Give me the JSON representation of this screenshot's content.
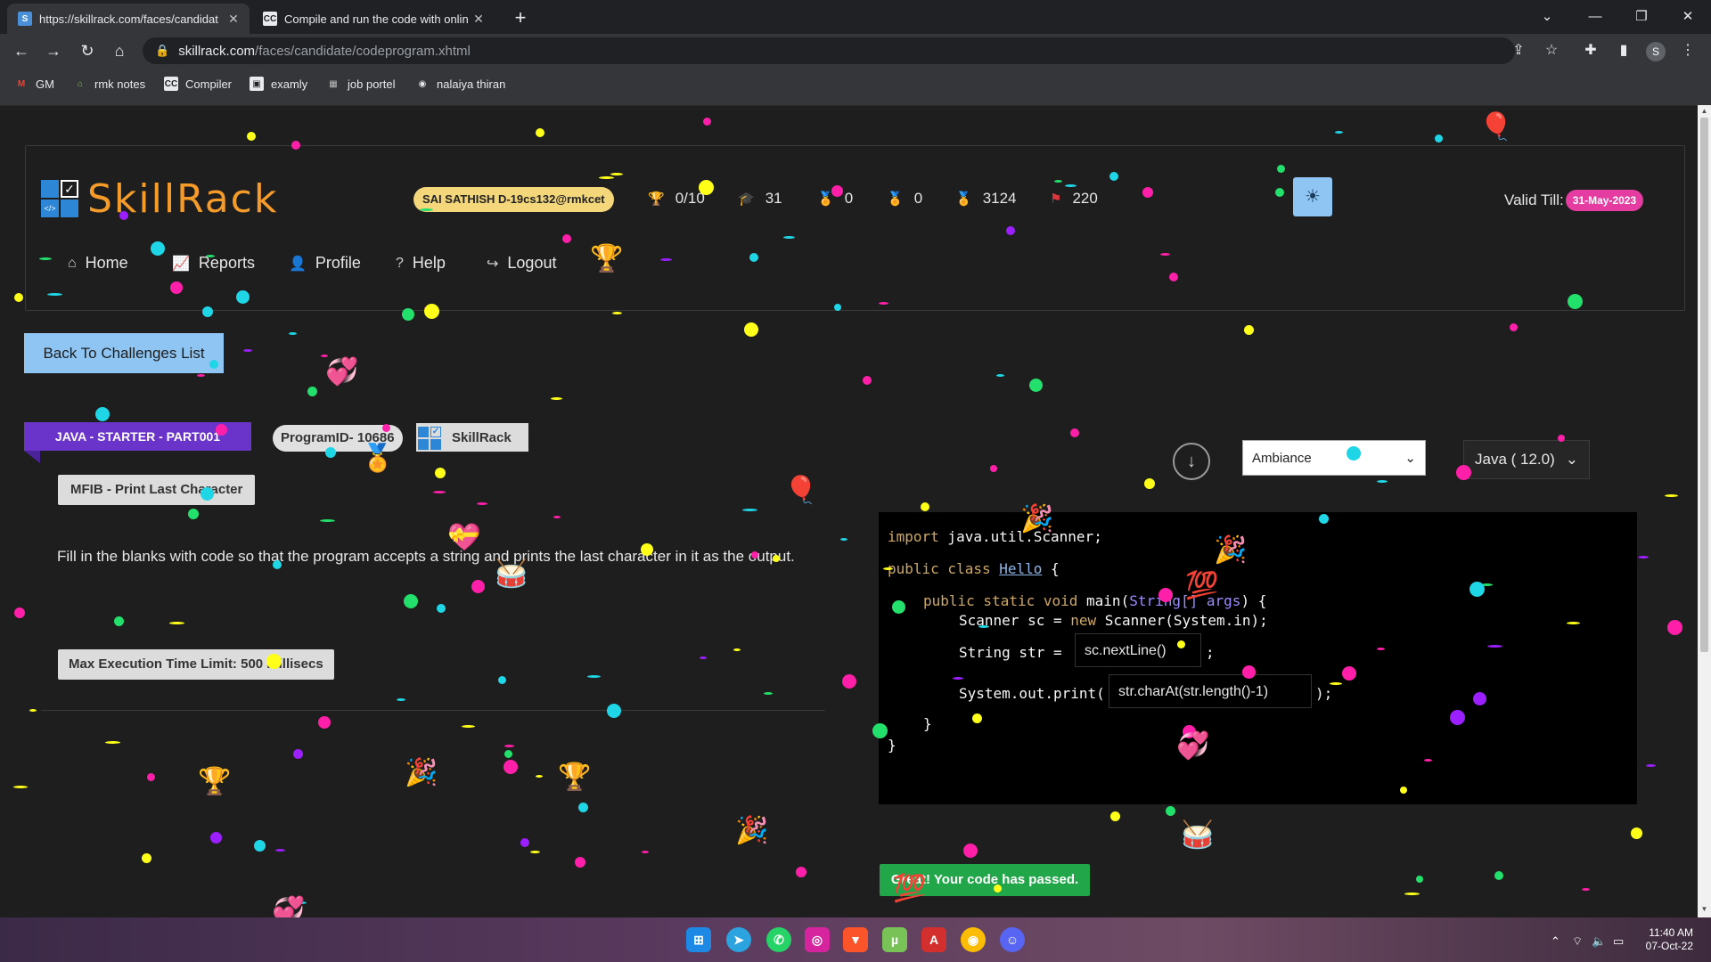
{
  "browser": {
    "tabs": [
      {
        "title": "https://skillrack.com/faces/candidat",
        "active": true
      },
      {
        "title": "Compile and run the code with onlin",
        "active": false
      }
    ],
    "url_host": "skillrack.com",
    "url_path": "/faces/candidate/codeprogram.xhtml",
    "profile_initial": "S",
    "bookmarks": [
      "GM",
      "rmk notes",
      "Compiler",
      "examly",
      "job portel",
      "nalaiya thiran"
    ]
  },
  "header": {
    "logo_text": "SkillRack",
    "user": "SAI SATHISH D-19cs132@rmkcet",
    "stats": [
      {
        "icon": "trophy-icon",
        "value": "0/10"
      },
      {
        "icon": "graduation-cap-icon",
        "value": "31"
      },
      {
        "icon": "gold-medal-icon",
        "value": "0"
      },
      {
        "icon": "silver-medal-icon",
        "value": "0"
      },
      {
        "icon": "bronze-medal-icon",
        "value": "3124"
      },
      {
        "icon": "flag-icon",
        "value": "220"
      }
    ],
    "valid_till_label": "Valid Till:",
    "valid_till_date": "31-May-2023",
    "nav": [
      {
        "icon": "home-icon",
        "label": "Home"
      },
      {
        "icon": "reports-icon",
        "label": "Reports"
      },
      {
        "icon": "profile-icon",
        "label": "Profile"
      },
      {
        "icon": "help-icon",
        "label": "Help"
      },
      {
        "icon": "logout-icon",
        "label": "Logout"
      }
    ]
  },
  "main": {
    "back_button": "Back To Challenges List",
    "course": "JAVA - STARTER - PART001",
    "program_id": "ProgramID- 10686",
    "brand_chip": "SkillRack",
    "problem_title": "MFIB - Print Last Character",
    "description": "Fill in the blanks with code so that the program accepts a string and prints the last character in it as the output.",
    "time_limit": "Max Execution Time Limit: 500 millisecs"
  },
  "editor": {
    "theme": "Ambiance",
    "language": "Java ( 12.0)",
    "code": {
      "line1_kw": "import",
      "line1_rest": " java.util.Scanner;",
      "line2_kw": "public class ",
      "line2_cls": "Hello",
      "line2_rest": " {",
      "line3_kw": "public static void ",
      "line3_fn": "main(",
      "line3_type": "String[] args",
      "line3_rest": ") {",
      "line4": "Scanner sc = ",
      "line4_kw": "new",
      "line4_rest": " Scanner(System.in);",
      "line5": "String str = ",
      "line5_end": ";",
      "line6": "System.out.print(",
      "line6_end": ");",
      "line7": "}",
      "line8": "}"
    },
    "blank1": "sc.nextLine()",
    "blank2": "str.charAt(str.length()-1)"
  },
  "status": {
    "pass_message": "Great! Your code has passed."
  },
  "taskbar": {
    "time": "11:40 AM",
    "date": "07-Oct-22"
  },
  "colors": {
    "accent": "#8ec5f2",
    "course_tag": "#6a33c9",
    "pass": "#21a64a",
    "valid_date": "#e43ca0"
  }
}
